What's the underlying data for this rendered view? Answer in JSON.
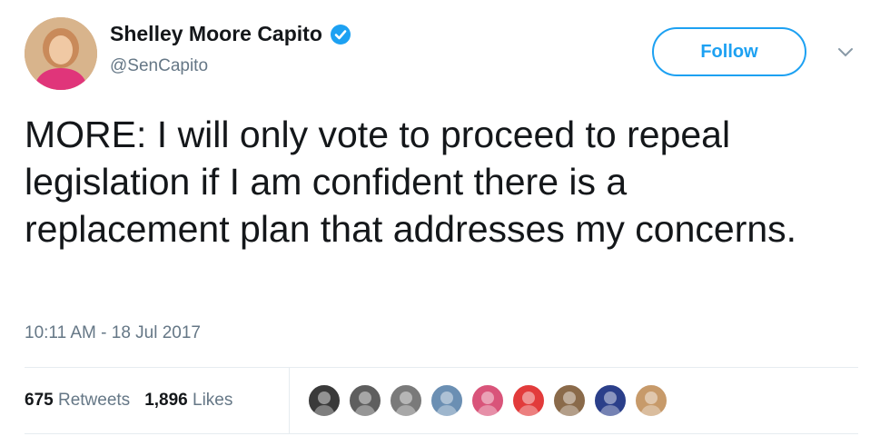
{
  "author": {
    "display_name": "Shelley Moore Capito",
    "handle": "@SenCapito",
    "verified": true
  },
  "actions": {
    "follow_label": "Follow",
    "menu_icon": "chevron-down-icon"
  },
  "tweet": {
    "text": "MORE: I will only vote to proceed to repeal legislation if I am confident there is a replacement plan that addresses my concerns.",
    "timestamp": "10:11 AM - 18 Jul 2017"
  },
  "stats": {
    "retweets_count": "675",
    "retweets_label": "Retweets",
    "likes_count": "1,896",
    "likes_label": "Likes"
  },
  "likers": [
    {
      "name": "liker-avatar-1",
      "color": "#3a3a3a"
    },
    {
      "name": "liker-avatar-2",
      "color": "#5e5e5e"
    },
    {
      "name": "liker-avatar-3",
      "color": "#7a7a7a"
    },
    {
      "name": "liker-avatar-4",
      "color": "#6b8fb3"
    },
    {
      "name": "liker-avatar-5",
      "color": "#d9547a"
    },
    {
      "name": "liker-avatar-6",
      "color": "#e23b3b"
    },
    {
      "name": "liker-avatar-7",
      "color": "#8a6a4a"
    },
    {
      "name": "liker-avatar-8",
      "color": "#2b3f8a"
    },
    {
      "name": "liker-avatar-9",
      "color": "#c79a6a"
    }
  ],
  "colors": {
    "accent": "#1da1f2",
    "text": "#14171a",
    "muted": "#657786",
    "avatar_bg": "#c9a27a"
  }
}
